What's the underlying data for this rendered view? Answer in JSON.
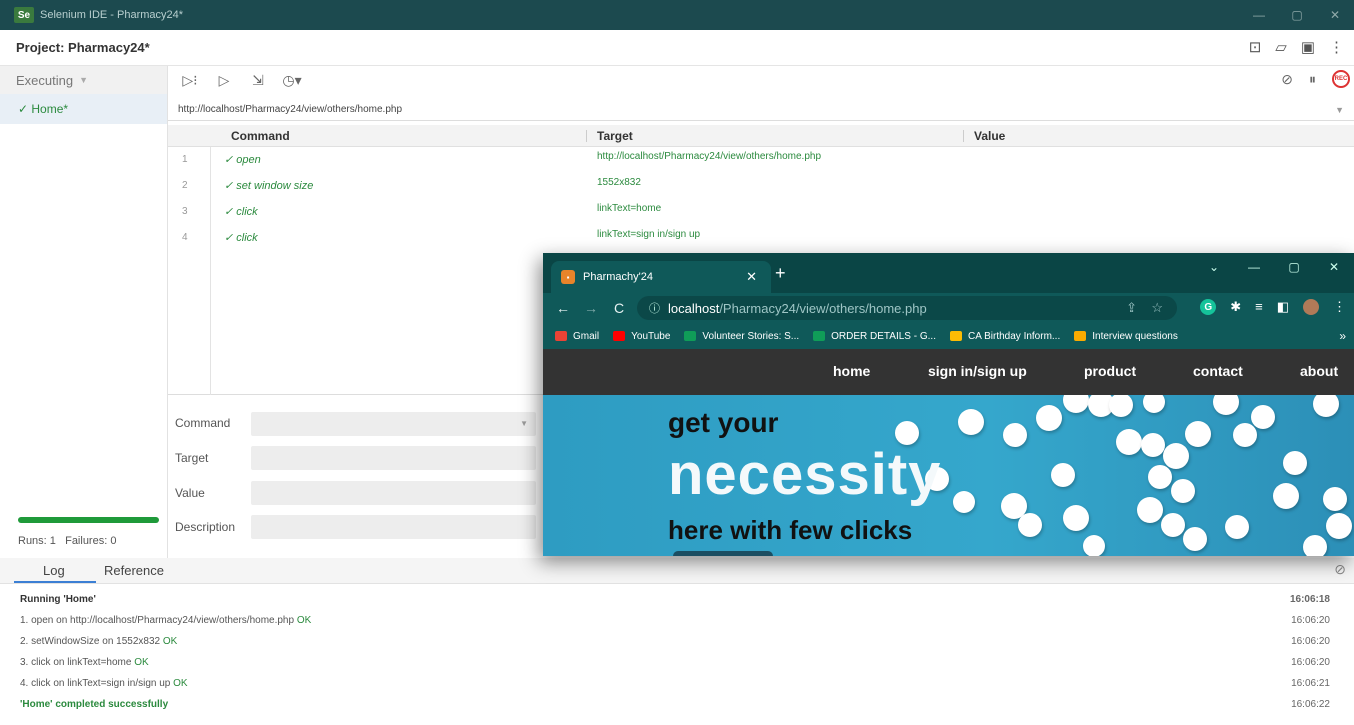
{
  "window": {
    "title": "Selenium IDE - Pharmacy24*",
    "logo": "Se"
  },
  "project": {
    "label": "Project:",
    "name": "Pharmacy24*"
  },
  "sidebar": {
    "status": "Executing",
    "tests": [
      {
        "label": "✓ Home*"
      }
    ],
    "runs_label": "Runs: 1",
    "failures_label": "Failures: 0",
    "progress": 1.0
  },
  "base_url": "http://localhost/Pharmacy24/view/others/home.php",
  "table": {
    "headers": {
      "command": "Command",
      "target": "Target",
      "value": "Value"
    },
    "rows": [
      {
        "n": "1",
        "command": "✓ open",
        "target": "http://localhost/Pharmacy24/view/others/home.php"
      },
      {
        "n": "2",
        "command": "✓ set window size",
        "target": "1552x832"
      },
      {
        "n": "3",
        "command": "✓ click",
        "target": "linkText=home"
      },
      {
        "n": "4",
        "command": "✓ click",
        "target": "linkText=sign in/sign up"
      }
    ]
  },
  "editor": {
    "command": "Command",
    "target": "Target",
    "value": "Value",
    "description": "Description"
  },
  "logpanel": {
    "tabs": {
      "log": "Log",
      "reference": "Reference"
    },
    "lines": [
      {
        "text": "Running 'Home'",
        "ok": "",
        "time": "16:06:18"
      },
      {
        "text": "1.  open on http://localhost/Pharmacy24/view/others/home.php",
        "ok": "OK",
        "time": "16:06:20"
      },
      {
        "text": "2.  setWindowSize on 1552x832",
        "ok": "OK",
        "time": "16:06:20"
      },
      {
        "text": "3.  click on linkText=home",
        "ok": "OK",
        "time": "16:06:20"
      },
      {
        "text": "4.  click on linkText=sign in/sign up",
        "ok": "OK",
        "time": "16:06:21"
      },
      {
        "text": "'Home' completed successfully",
        "ok": "",
        "time": "16:06:22"
      }
    ]
  },
  "browser": {
    "tab_title": "Pharmachy'24",
    "url_host": "localhost",
    "url_path": "/Pharmacy24/view/others/home.php",
    "bookmarks": [
      {
        "label": "Gmail",
        "color": "#ea4335"
      },
      {
        "label": "YouTube",
        "color": "#ff0000"
      },
      {
        "label": "Volunteer Stories: S...",
        "color": "#0f9d58"
      },
      {
        "label": "ORDER DETAILS - G...",
        "color": "#0f9d58"
      },
      {
        "label": "CA Birthday Inform...",
        "color": "#fbbc04"
      },
      {
        "label": "Interview questions",
        "color": "#f9ab00"
      }
    ],
    "nav": {
      "home": "home",
      "signin": "sign in/sign up",
      "product": "product",
      "contact": "contact",
      "about": "about"
    },
    "hero": {
      "line1": "get your",
      "line2": "necessity",
      "line3": "here with few clicks"
    }
  }
}
